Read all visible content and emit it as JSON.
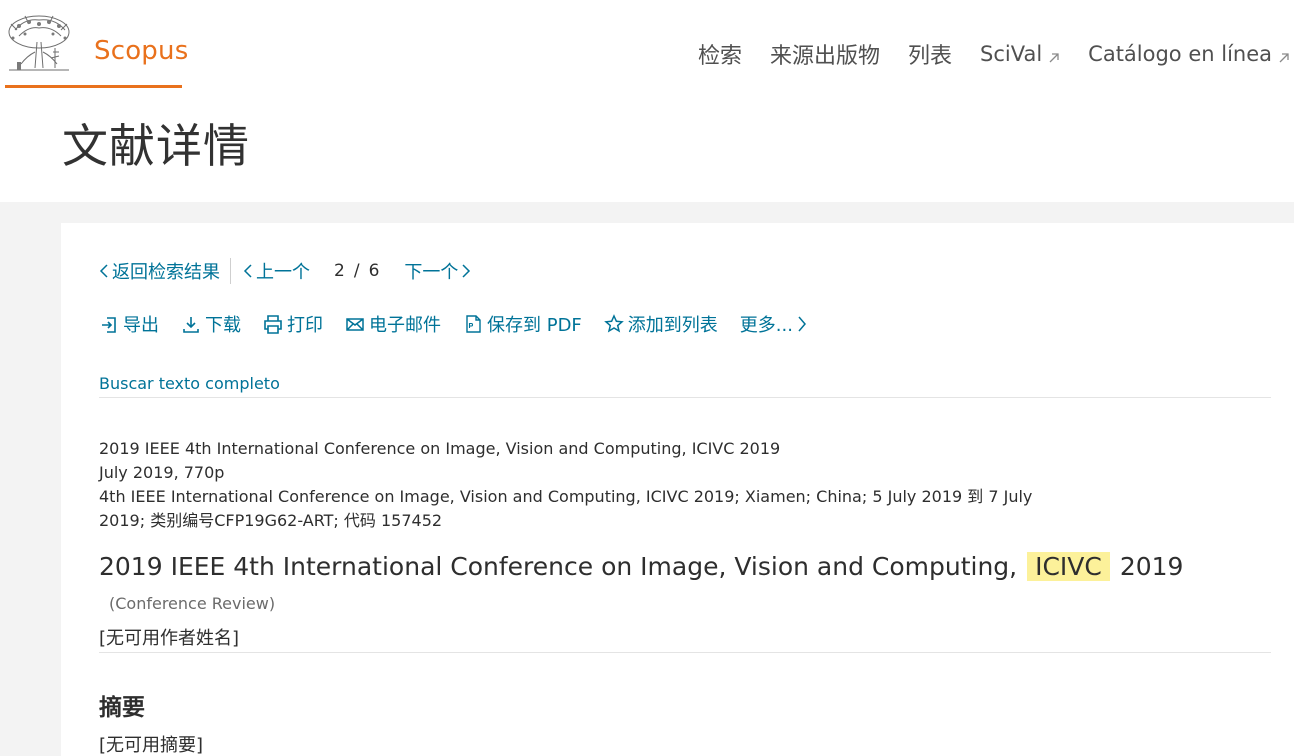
{
  "header": {
    "logo_text": "Scopus",
    "accent_color": "#e9711c",
    "nav": [
      {
        "label": "检索",
        "external": false
      },
      {
        "label": "来源出版物",
        "external": false
      },
      {
        "label": "列表",
        "external": false
      },
      {
        "label": "SciVal",
        "external": true
      },
      {
        "label": "Catálogo en línea",
        "external": true
      }
    ]
  },
  "page": {
    "title": "文献详情"
  },
  "navigation": {
    "back_label": "返回检索结果",
    "prev_label": "上一个",
    "current": "2",
    "total": "6",
    "next_label": "下一个"
  },
  "actions": {
    "export": "导出",
    "download": "下载",
    "print": "打印",
    "email": "电子邮件",
    "save_pdf": "保存到 PDF",
    "add_to_list": "添加到列表",
    "more": "更多..."
  },
  "full_text_link": "Buscar texto completo",
  "record": {
    "meta_lines": [
      "2019 IEEE 4th International Conference on Image, Vision and Computing, ICIVC 2019",
      "July 2019, 770p",
      "4th IEEE International Conference on Image, Vision and Computing, ICIVC 2019; Xiamen; China; 5 July 2019 到 7 July 2019; 类别编号CFP19G62-ART; 代码 157452"
    ],
    "title_before": "2019 IEEE 4th International Conference on Image, Vision and Computing,",
    "title_highlight": "ICIVC",
    "title_after": "2019",
    "doc_type": "(Conference Review)",
    "authors": "[无可用作者姓名]",
    "abstract_heading": "摘要",
    "abstract_body": "[无可用摘要]"
  }
}
